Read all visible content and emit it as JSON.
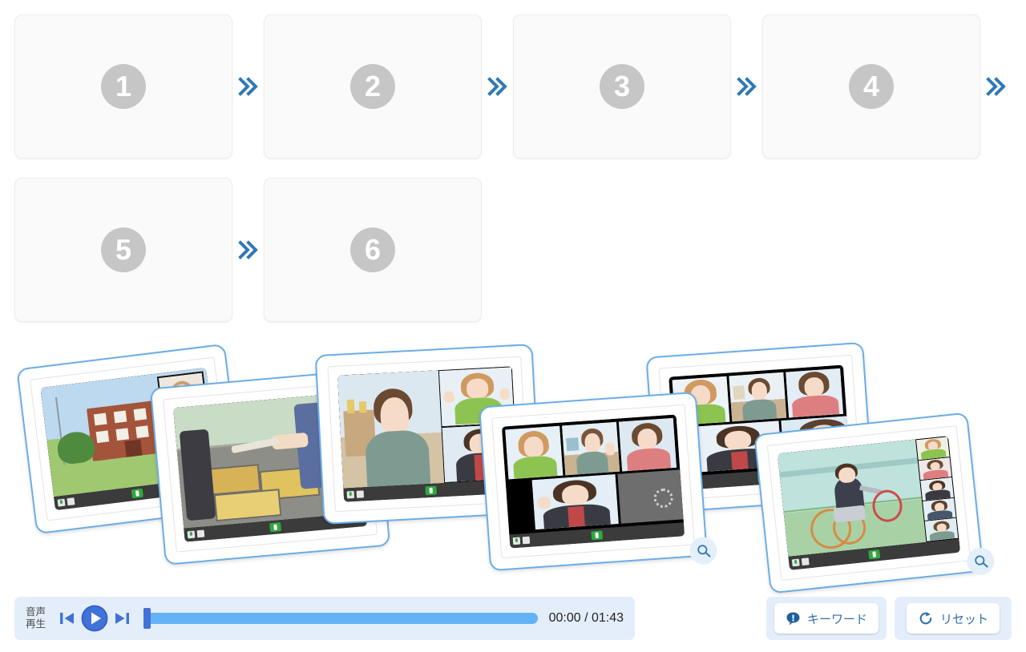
{
  "sequence": {
    "rows": [
      {
        "slots": [
          {
            "number": "1",
            "state": "empty"
          },
          {
            "number": "2",
            "state": "empty"
          },
          {
            "number": "3",
            "state": "empty"
          },
          {
            "number": "4",
            "state": "empty"
          }
        ],
        "trailing_arrow": true
      },
      {
        "slots": [
          {
            "number": "5",
            "state": "empty"
          },
          {
            "number": "6",
            "state": "empty"
          }
        ],
        "trailing_arrow": false
      }
    ],
    "arrow_icon": "double-chevron-right-icon",
    "arrow_color": "#2f79b5",
    "slot_background": "#fafafa",
    "slot_number_color": "#c6c6c6"
  },
  "card_stack": {
    "border_color": "#6badE6",
    "zoom_icon": "magnifier-icon",
    "cards": [
      {
        "id": "card-1",
        "caption": "school-building-video-call",
        "has_zoom_button": false
      },
      {
        "id": "card-2",
        "caption": "food-serving-video-call",
        "has_zoom_button": false
      },
      {
        "id": "card-3",
        "caption": "three-person-meeting-video-call",
        "has_zoom_button": true
      },
      {
        "id": "card-4",
        "caption": "five-person-grid-video-call",
        "has_zoom_button": true
      },
      {
        "id": "card-5",
        "caption": "six-person-grid-video-call",
        "has_zoom_button": false
      },
      {
        "id": "card-6",
        "caption": "wheelchair-tennis-video-call",
        "has_zoom_button": true
      }
    ]
  },
  "player": {
    "label_line1": "音声",
    "label_line2": "再生",
    "prev_icon": "skip-previous-icon",
    "play_icon": "play-circle-icon",
    "next_icon": "skip-next-icon",
    "time_display": "00:00 / 01:43",
    "current_time": "00:00",
    "duration": "01:43",
    "progress_percent": 0,
    "track_color": "#64b2f6",
    "thumb_color": "#4172d8",
    "panel_color": "#e4eefb"
  },
  "actions": {
    "keyword": {
      "label": "キーワード",
      "icon": "exclamation-bubble-icon"
    },
    "reset": {
      "label": "リセット",
      "icon": "refresh-icon"
    }
  }
}
